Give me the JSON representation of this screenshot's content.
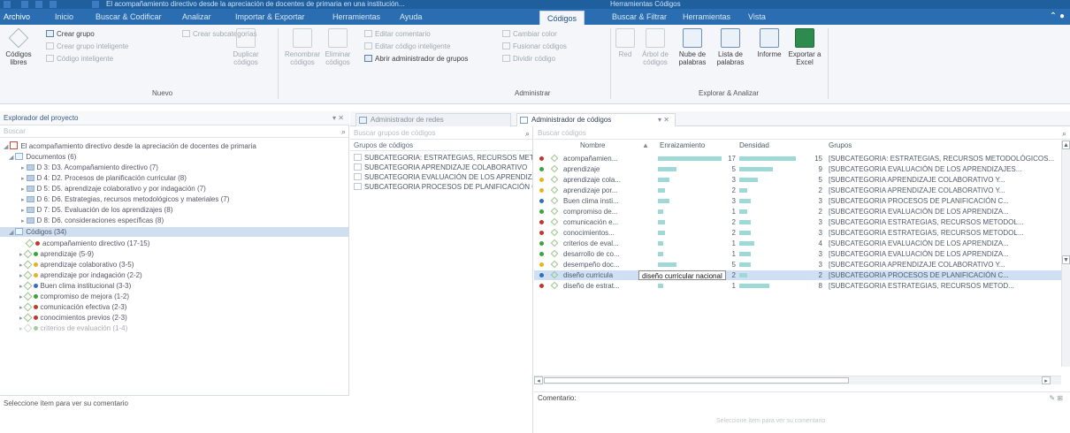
{
  "window": {
    "title": "El acompañamiento directivo desde la apreciación de docentes de primaria en una institución...",
    "context_title": "Herramientas Códigos",
    "collapse_icon": "chevron-up-icon",
    "help_icon": "help-icon"
  },
  "ribbon_tabs": [
    {
      "label": "Archivo"
    },
    {
      "label": "Inicio"
    },
    {
      "label": "Buscar & Codificar"
    },
    {
      "label": "Analizar"
    },
    {
      "label": "Importar & Exportar"
    },
    {
      "label": "Herramientas"
    },
    {
      "label": "Ayuda"
    },
    {
      "label": "Códigos"
    },
    {
      "label": "Buscar & Filtrar"
    },
    {
      "label": "Herramientas"
    },
    {
      "label": "Vista"
    }
  ],
  "ribbon": {
    "codigos_libres": "Códigos libres",
    "crear_grupo": "Crear grupo",
    "crear_grupo_inteligente": "Crear grupo inteligente",
    "codigo_inteligente": "Código inteligente",
    "crear_subcategorias": "Crear subcategorías",
    "duplicar_codigos": "Duplicar códigos",
    "nuevo_label": "Nuevo",
    "renombrar_codigos": "Renombrar códigos",
    "eliminar_codigos": "Eliminar códigos",
    "editar_comentario": "Editar comentario",
    "editar_codigo_inteligente": "Editar código inteligente",
    "abrir_admin_grupos": "Abrir administrador de grupos",
    "cambiar_color": "Cambiar color",
    "fusionar_codigos": "Fusionar códigos",
    "dividir_codigo": "Dividir código",
    "administrar_label": "Administrar",
    "red": "Red",
    "arbol_de_codigos": "Árbol de códigos",
    "nube_de_palabras": "Nube de palabras",
    "lista_de_palabras": "Lista de palabras",
    "informe": "Informe",
    "exportar_excel": "Exportar a Excel",
    "explorar_label": "Explorar & Analizar"
  },
  "project_explorer": {
    "title": "Explorador del proyecto",
    "search_placeholder": "Buscar",
    "project_name": "El acompañamiento directivo desde la apreciación de docentes de primaria",
    "documents_label": "Documentos (6)",
    "documents": [
      "D 3: D3. Acompañamiento directivo (7)",
      "D 4: D2. Procesos de planificación curricular (8)",
      "D 5: D5. aprendizaje colaborativo y por indagación (7)",
      "D 6: D6. Estrategias, recursos metodológicos y materiales (7)",
      "D 7: D5. Evaluación de los aprendizajes (8)",
      "D 8: D6. consideraciones específicas (8)"
    ],
    "codes_label": "Códigos (34)",
    "codes": [
      {
        "label": "acompañamiento directivo (17-15)",
        "color": "#c0392b"
      },
      {
        "label": "aprendizaje (5-9)",
        "color": "#3aa63a"
      },
      {
        "label": "aprendizaje colaborativo (3-5)",
        "color": "#e6b422"
      },
      {
        "label": "aprendizaje por indagación (2-2)",
        "color": "#e6b422"
      },
      {
        "label": "Buen clima institucional (3-3)",
        "color": "#2f6fc1"
      },
      {
        "label": "compromiso de mejora (1-2)",
        "color": "#3aa63a"
      },
      {
        "label": "comunicación efectiva (2-3)",
        "color": "#c0392b"
      },
      {
        "label": "conocimientos previos (2-3)",
        "color": "#c0392b"
      },
      {
        "label": "criterios de evaluación (1-4)",
        "color": "#3aa63a"
      }
    ],
    "comment_prompt": "Seleccione ítem para ver su comentario"
  },
  "doc_tabs": [
    {
      "label": "Administrador de redes"
    },
    {
      "label": "Administrador de códigos"
    }
  ],
  "groups_pane": {
    "search_placeholder": "Buscar grupos de códigos",
    "column_header": "Grupos de códigos",
    "groups": [
      "SUBCATEGORIA: ESTRATEGIAS, RECURSOS METODOLÓGICOS",
      "SUBCATEGORIA APRENDIZAJE COLABORATIVO",
      "SUBCATEGORIA EVALUACIÓN DE LOS APRENDIZAJES",
      "SUBCATEGORIA PROCESOS DE PLANIFICACIÓN CURRICULAR"
    ]
  },
  "codes_grid": {
    "search_placeholder": "Buscar códigos",
    "columns": {
      "name": "Nombre",
      "grounded": "Enraizamiento",
      "density": "Densidad",
      "groups": "Grupos"
    },
    "rows": [
      {
        "name": "acompañamien...",
        "color": "#c0392b",
        "grounded": 17,
        "density": 15,
        "groups": "[SUBCATEGORIA: ESTRATEGIAS, RECURSOS METODOLÓGICOS..."
      },
      {
        "name": "aprendizaje",
        "color": "#3aa63a",
        "grounded": 5,
        "density": 9,
        "groups": "[SUBCATEGORIA EVALUACIÓN DE LOS APRENDIZAJES..."
      },
      {
        "name": "aprendizaje cola...",
        "color": "#e6b422",
        "grounded": 3,
        "density": 5,
        "groups": "[SUBCATEGORIA APRENDIZAJE COLABORATIVO Y..."
      },
      {
        "name": "aprendizaje por...",
        "color": "#e6b422",
        "grounded": 2,
        "density": 2,
        "groups": "[SUBCATEGORIA APRENDIZAJE COLABORATIVO Y..."
      },
      {
        "name": "Buen clima insti...",
        "color": "#2f6fc1",
        "grounded": 3,
        "density": 3,
        "groups": "[SUBCATEGORIA PROCESOS DE PLANIFICACIÓN C..."
      },
      {
        "name": "compromiso de...",
        "color": "#3aa63a",
        "grounded": 1,
        "density": 2,
        "groups": "[SUBCATEGORIA EVALUACIÓN DE LOS APRENDIZA..."
      },
      {
        "name": "comunicación e...",
        "color": "#c0392b",
        "grounded": 2,
        "density": 3,
        "groups": "[SUBCATEGORIA ESTRATEGIAS, RECURSOS METODOL..."
      },
      {
        "name": "conocimientos...",
        "color": "#c0392b",
        "grounded": 2,
        "density": 3,
        "groups": "[SUBCATEGORIA ESTRATEGIAS, RECURSOS METODOL..."
      },
      {
        "name": "criterios de eval...",
        "color": "#3aa63a",
        "grounded": 1,
        "density": 4,
        "groups": "[SUBCATEGORIA EVALUACIÓN DE LOS APRENDIZA..."
      },
      {
        "name": "desarrollo de co...",
        "color": "#3aa63a",
        "grounded": 1,
        "density": 3,
        "groups": "[SUBCATEGORIA EVALUACIÓN DE LOS APRENDIZA..."
      },
      {
        "name": "desempeño doc...",
        "color": "#e6b422",
        "grounded": 5,
        "density": 3,
        "groups": "[SUBCATEGORIA APRENDIZAJE COLABORATIVO Y..."
      },
      {
        "name": "diseño curricula",
        "color": "#2f6fc1",
        "grounded": 2,
        "density": 2,
        "groups": "[SUBCATEGORIA PROCESOS DE PLANIFICACIÓN C...",
        "selected": true,
        "tooltip": "diseño curricular nacional"
      },
      {
        "name": "diseño de estrat...",
        "color": "#c0392b",
        "grounded": 1,
        "density": 8,
        "groups": "[SUBCATEGORIA ESTRATEGIAS, RECURSOS METOD..."
      }
    ],
    "comment_label": "Comentario:",
    "comment_empty": "Seleccione ítem para ver su comentario"
  }
}
